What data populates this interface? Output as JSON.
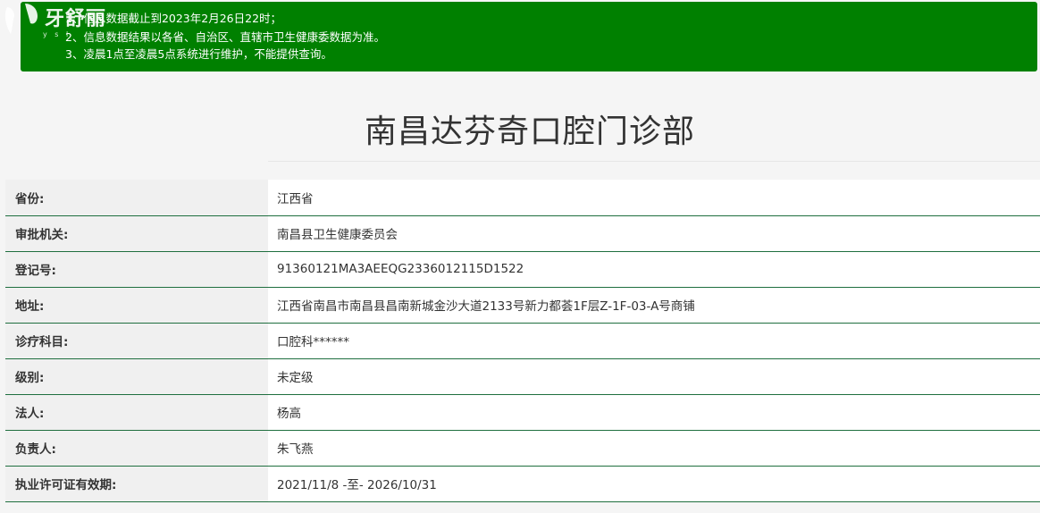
{
  "notice": {
    "lines": [
      "1、信息数据截止到2023年2月26日22时；",
      "2、信息数据结果以各省、自治区、直辖市卫生健康委数据为准。",
      "3、凌晨1点至凌晨5点系统进行维护，不能提供查询。"
    ]
  },
  "watermark": {
    "brand": "牙舒丽",
    "sub": "y s l"
  },
  "page": {
    "title": "南昌达芬奇口腔门诊部"
  },
  "details": {
    "rows": [
      {
        "label": "省份:",
        "value": "江西省"
      },
      {
        "label": "审批机关:",
        "value": "南昌县卫生健康委员会"
      },
      {
        "label": "登记号:",
        "value": "91360121MA3AEEQG2336012115D1522"
      },
      {
        "label": "地址:",
        "value": "江西省南昌市南昌县昌南新城金沙大道2133号新力都荟1F层Z-1F-03-A号商铺"
      },
      {
        "label": "诊疗科目:",
        "value": "口腔科******"
      },
      {
        "label": "级别:",
        "value": "未定级"
      },
      {
        "label": "法人:",
        "value": "杨高"
      },
      {
        "label": "负责人:",
        "value": "朱飞燕"
      },
      {
        "label": "执业许可证有效期:",
        "value": "2021/11/8 -至- 2026/10/31"
      }
    ]
  },
  "colors": {
    "banner": "#008000",
    "row_border": "#1f6f3f",
    "label_bg": "#f0f0f0",
    "value_bg": "#ffffff"
  }
}
